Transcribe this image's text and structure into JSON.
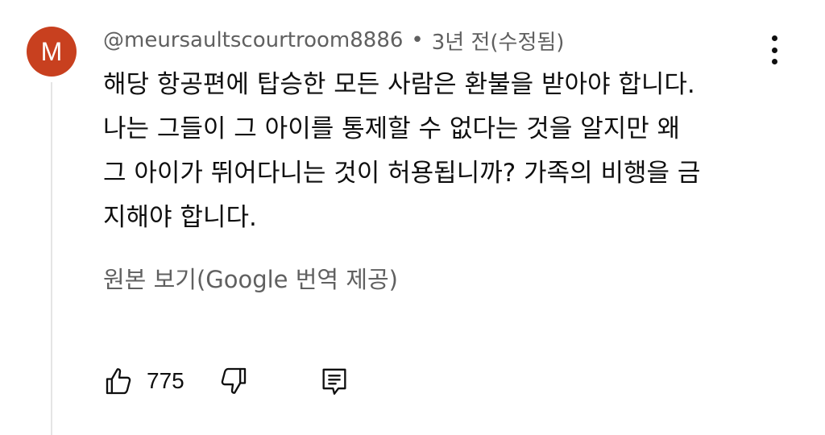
{
  "avatar": {
    "letter": "M",
    "color": "#c8401f"
  },
  "header": {
    "username": "@meursaultscourtroom8886",
    "separator": "•",
    "time": "3년 전(수정됨)"
  },
  "comment": {
    "lines": [
      "해당 항공편에 탑승한 모든 사람은 환불을 받아야 합니다.",
      "나는 그들이 그 아이를 통제할 수 없다는 것을 알지만 왜",
      "그 아이가 뛰어다니는 것이 허용됩니까? 가족의 비행을 금",
      "지해야 합니다."
    ]
  },
  "translate_link": "원본 보기(Google 번역 제공)",
  "actions": {
    "like_icon": "thumbs-up-icon",
    "like_count": "775",
    "dislike_icon": "thumbs-down-icon",
    "reply_icon": "comment-reply-icon"
  },
  "menu_icon": "more-vert-icon"
}
